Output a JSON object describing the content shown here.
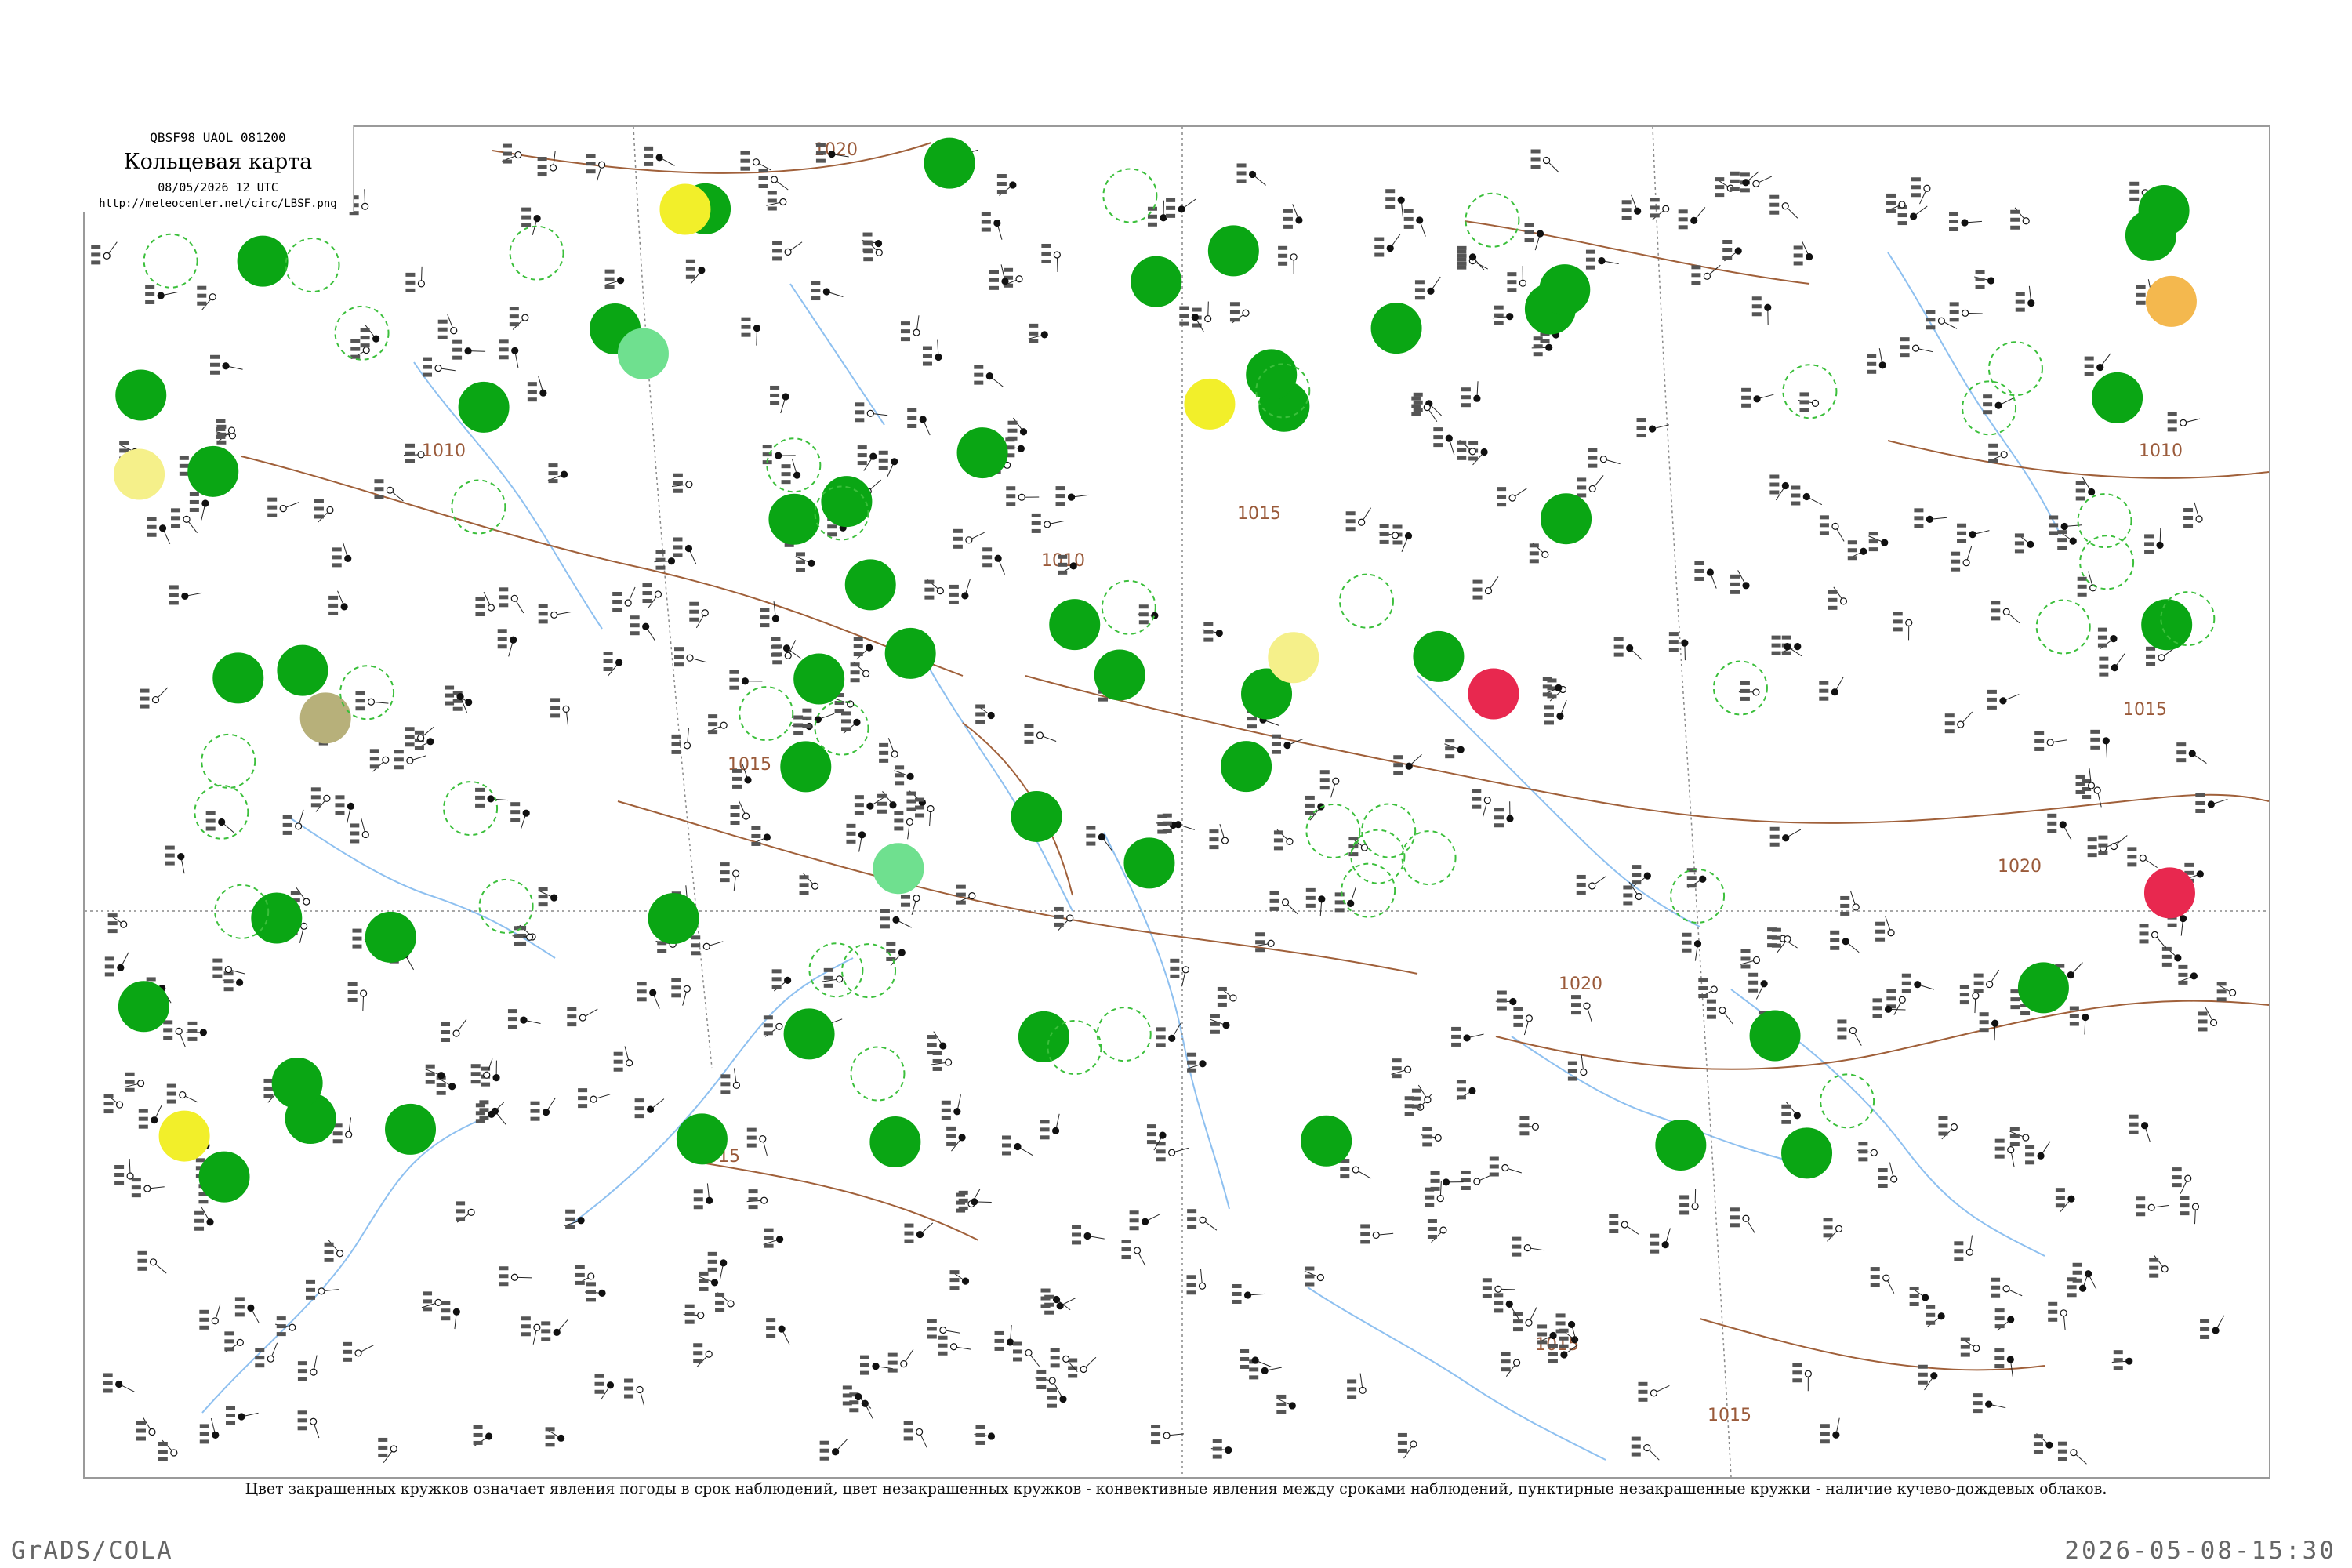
{
  "header": {
    "code_line": "QBSF98  UAOL  081200",
    "title": "Кольцевая карта",
    "date_line": "08/05/2026 12 UTC",
    "url": "http://meteocenter.net/circ/LBSF.png"
  },
  "caption": "Цвет закрашенных кружков означает явления погоды в срок наблюдений, цвет незакрашенных кружков - конвективные явления между сроками наблюдений, пунктирные незакрашенные кружки - наличие кучево-дождевых облаков.",
  "footer": {
    "left": "GrADS/COLA",
    "right": "2026-05-08-15:30"
  },
  "isobar_labels": [
    "1020",
    "1015",
    "1010",
    "1015",
    "1010",
    "1015",
    "1020",
    "1015",
    "1015",
    "1020",
    "1015",
    "1010"
  ],
  "colors": {
    "rain": "#0aa614",
    "light_rain": "#6fe08f",
    "drizzle": "#f2ef2a",
    "fog": "#f5f08a",
    "haze": "#f4b84e",
    "thunderstorm": "#e8284f",
    "dust": "#b7b07a",
    "cb_ring": "#3bbf3b",
    "isobar": "#a0603a",
    "river": "#8ec0f0",
    "border": "#888888"
  },
  "legend_colors": [
    "rain",
    "light_rain",
    "drizzle",
    "fog",
    "haze",
    "thunderstorm",
    "dust"
  ]
}
